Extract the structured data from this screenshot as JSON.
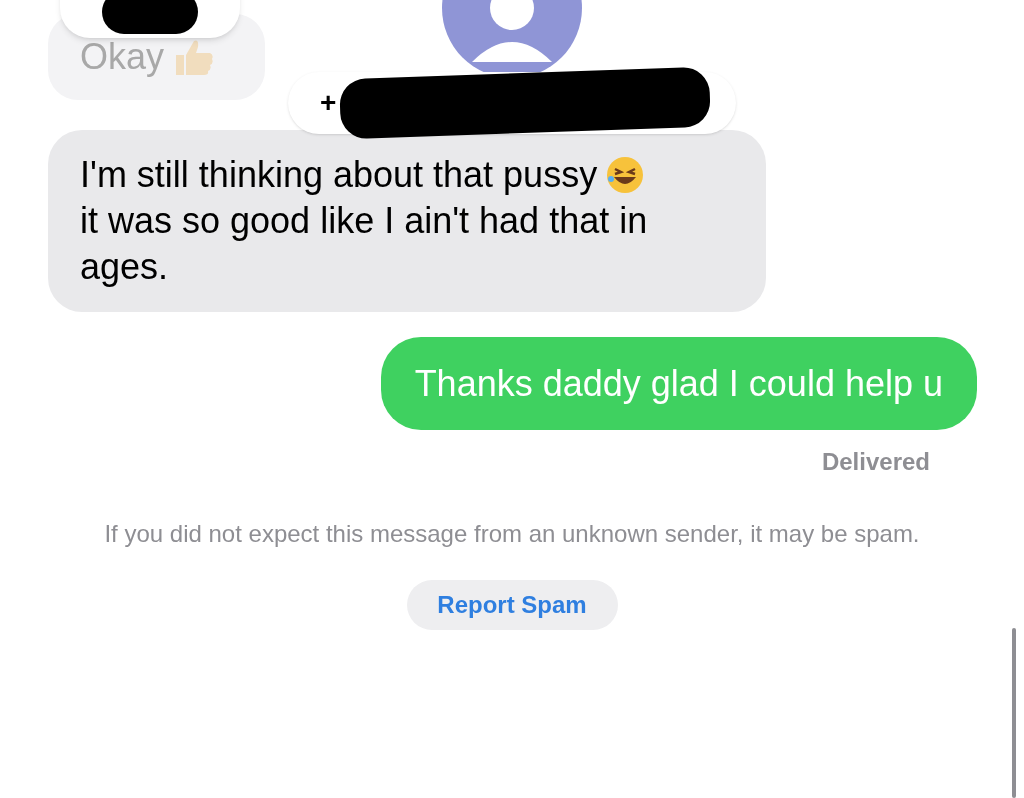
{
  "earlier_message": {
    "text": "Okay"
  },
  "contact": {
    "name_visible": "+",
    "redacted": true
  },
  "messages": [
    {
      "kind": "received",
      "text": "I'm still thinking about that pussy"
    },
    {
      "kind": "received_cont",
      "text": "it was so good like I ain't had that in ages."
    },
    {
      "kind": "sent",
      "text": "Thanks daddy glad I could help u"
    }
  ],
  "status": "Delivered",
  "spam_notice": "If you did not expect this message from an unknown sender, it may be spam.",
  "report_button": "Report Spam"
}
